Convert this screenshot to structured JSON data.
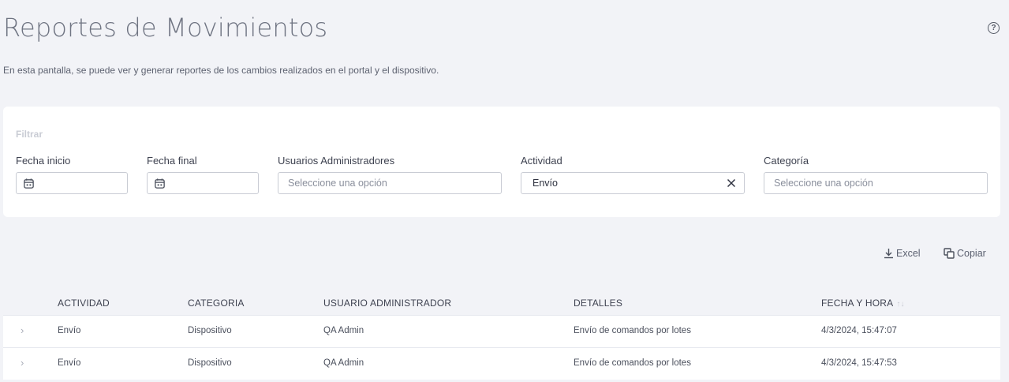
{
  "header": {
    "title": "Reportes de Movimientos",
    "description": "En esta pantalla, se puede ver y generar reportes de los cambios realizados en el portal y el dispositivo.",
    "help_icon_glyph": "?"
  },
  "filters": {
    "title": "Filtrar",
    "start_date": {
      "label": "Fecha inicio",
      "value": ""
    },
    "end_date": {
      "label": "Fecha final",
      "value": ""
    },
    "admin_users": {
      "label": "Usuarios Administradores",
      "placeholder": "Seleccione una opción"
    },
    "activity": {
      "label": "Actividad",
      "value": "Envío"
    },
    "category": {
      "label": "Categoría",
      "placeholder": "Seleccione una opción"
    }
  },
  "toolbar": {
    "excel_label": "Excel",
    "copy_label": "Copiar"
  },
  "table": {
    "columns": {
      "activity": "ACTIVIDAD",
      "category": "CATEGORIA",
      "admin_user": "USUARIO ADMINISTRADOR",
      "details": "DETALLES",
      "datetime": "FECHA Y HORA"
    },
    "sort_glyph": "↑↓",
    "rows": [
      {
        "activity": "Envío",
        "category": "Dispositivo",
        "admin_user": "QA Admin",
        "details": "Envío de comandos por lotes",
        "datetime": "4/3/2024, 15:47:07"
      },
      {
        "activity": "Envío",
        "category": "Dispositivo",
        "admin_user": "QA Admin",
        "details": "Envío de comandos por lotes",
        "datetime": "4/3/2024, 15:47:53"
      }
    ],
    "expand_glyph": "›"
  }
}
